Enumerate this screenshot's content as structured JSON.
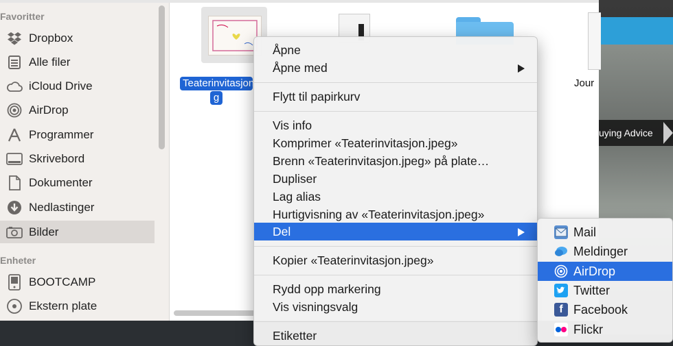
{
  "sidebar": {
    "favorites_header": "Favoritter",
    "devices_header": "Enheter",
    "favorites": [
      {
        "label": "Dropbox",
        "icon": "dropbox-icon"
      },
      {
        "label": "Alle filer",
        "icon": "all-files-icon"
      },
      {
        "label": "iCloud Drive",
        "icon": "cloud-icon"
      },
      {
        "label": "AirDrop",
        "icon": "airdrop-icon"
      },
      {
        "label": "Programmer",
        "icon": "applications-icon"
      },
      {
        "label": "Skrivebord",
        "icon": "desktop-icon"
      },
      {
        "label": "Dokumenter",
        "icon": "documents-icon"
      },
      {
        "label": "Nedlastinger",
        "icon": "downloads-icon"
      },
      {
        "label": "Bilder",
        "icon": "camera-icon",
        "selected": true
      }
    ],
    "devices": [
      {
        "label": "BOOTCAMP",
        "icon": "drive-icon"
      },
      {
        "label": "Ekstern plate",
        "icon": "disk-icon"
      }
    ]
  },
  "files": {
    "selected_name_line1": "Teaterinvitasjon",
    "selected_name_line2": "g",
    "partial_name": "Jour"
  },
  "background": {
    "caption": "uying Advice",
    "accent": "#2d9fd8"
  },
  "context_menu": {
    "items": {
      "open": "Åpne",
      "open_with": "Åpne med",
      "trash": "Flytt til papirkurv",
      "info": "Vis info",
      "compress": "Komprimer «Teaterinvitasjon.jpeg»",
      "burn": "Brenn «Teaterinvitasjon.jpeg» på plate…",
      "duplicate": "Dupliser",
      "alias": "Lag alias",
      "quicklook": "Hurtigvisning av «Teaterinvitasjon.jpeg»",
      "share": "Del",
      "copy": "Kopier «Teaterinvitasjon.jpeg»",
      "cleanup": "Rydd opp markering",
      "view_options": "Vis visningsvalg",
      "tags": "Etiketter"
    },
    "highlight_color": "#2a6fe0"
  },
  "share_menu": {
    "items": [
      {
        "label": "Mail",
        "icon": "mail-icon"
      },
      {
        "label": "Meldinger",
        "icon": "messages-icon"
      },
      {
        "label": "AirDrop",
        "icon": "airdrop-icon",
        "highlighted": true
      },
      {
        "label": "Twitter",
        "icon": "twitter-icon"
      },
      {
        "label": "Facebook",
        "icon": "facebook-icon"
      },
      {
        "label": "Flickr",
        "icon": "flickr-icon"
      }
    ]
  }
}
